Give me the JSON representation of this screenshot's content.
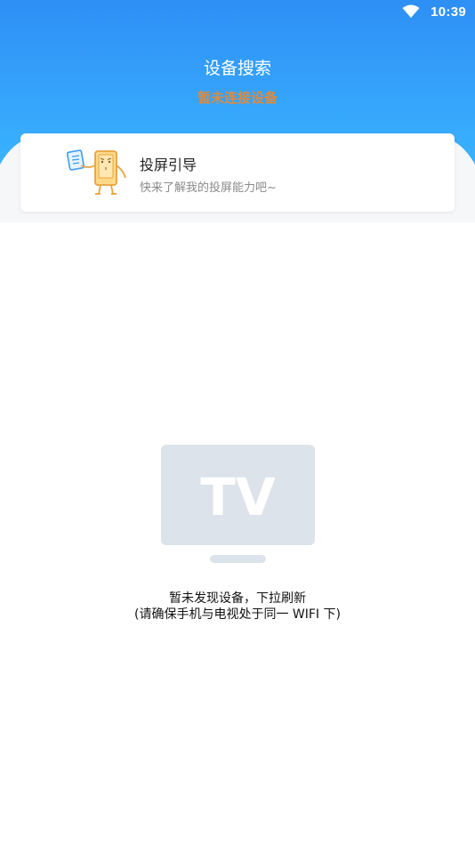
{
  "status_bar": {
    "time": "10:39",
    "icons": [
      "wifi-icon"
    ]
  },
  "header": {
    "title": "设备搜索",
    "subtitle": "暂未连接设备",
    "gradient_top": "#2e8ff5",
    "gradient_bottom": "#3ab2ff",
    "subtitle_color": "#e08a3c"
  },
  "guide_card": {
    "title": "投屏引导",
    "description": "快来了解我的投屏能力吧~",
    "icon": "cast-guide-mascot-icon"
  },
  "empty_state": {
    "icon": "tv-icon",
    "icon_text": "TV",
    "message_line1": "暂未发现设备，下拉刷新",
    "message_line2": "(请确保手机与电视处于同一 WIFI 下)"
  }
}
